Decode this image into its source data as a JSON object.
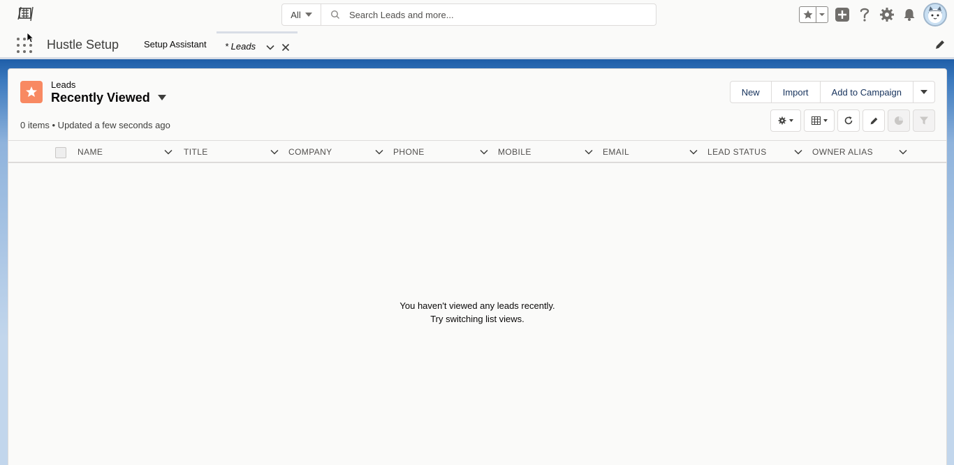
{
  "header": {
    "search_scope": "All",
    "search_placeholder": "Search Leads and more...",
    "icons": [
      "app-logo-icon",
      "search-icon",
      "star-icon",
      "chevron-down-icon",
      "plus-icon",
      "help-icon",
      "gear-icon",
      "bell-icon",
      "avatar"
    ]
  },
  "nav": {
    "app_name": "Hustle Setup",
    "tabs": [
      {
        "label": "Setup Assistant"
      },
      {
        "label": "* Leads",
        "active": true
      }
    ]
  },
  "list": {
    "object_label": "Leads",
    "view_name": "Recently Viewed",
    "meta": "0 items • Updated a few seconds ago",
    "actions": [
      "New",
      "Import",
      "Add to Campaign"
    ],
    "columns": [
      "NAME",
      "TITLE",
      "COMPANY",
      "PHONE",
      "MOBILE",
      "EMAIL",
      "LEAD STATUS",
      "OWNER ALIAS"
    ],
    "empty_line1": "You haven't viewed any leads recently.",
    "empty_line2": "Try switching list views."
  },
  "colors": {
    "lead_icon": "#f88962",
    "backdrop": "#1f5ea8",
    "text": "#080707",
    "button_text": "#16325c"
  }
}
